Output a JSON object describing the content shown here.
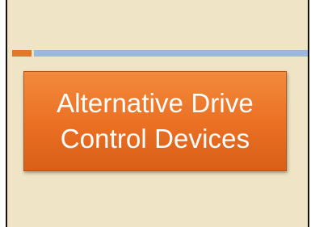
{
  "slide": {
    "title": "Alternative Drive\nControl Devices"
  },
  "colors": {
    "background": "#efe4c5",
    "accent_orange": "#e2762f",
    "accent_blue": "#9cbad7",
    "title_box": "#ea6f23",
    "title_text": "#ffffff"
  }
}
